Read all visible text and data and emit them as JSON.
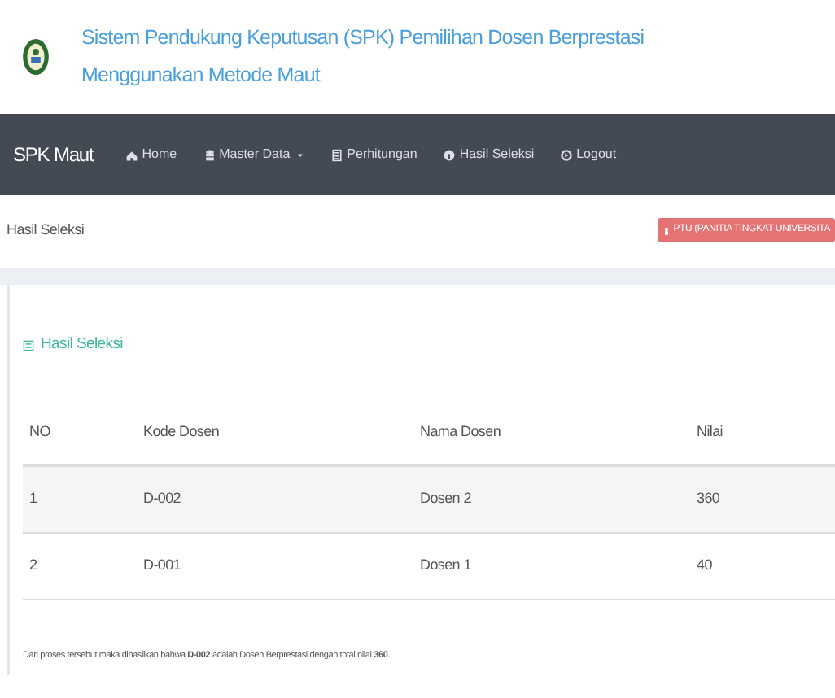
{
  "header": {
    "title_line_1": "Sistem Pendukung Keputusan (SPK) Pemilihan Dosen Berprestasi",
    "title_line_2": "Menggunakan Metode Maut"
  },
  "navbar": {
    "brand": "SPK Maut",
    "items": [
      {
        "label": "Home",
        "kind": "home",
        "dropdown": false
      },
      {
        "label": "Master Data",
        "kind": "database",
        "dropdown": true
      },
      {
        "label": "Perhitungan",
        "kind": "calculator",
        "dropdown": false
      },
      {
        "label": "Hasil Seleksi",
        "kind": "info",
        "dropdown": false
      },
      {
        "label": "Logout",
        "kind": "logout",
        "dropdown": false
      }
    ]
  },
  "page_title": "Hasil Seleksi",
  "user_button": "PTU (PANITIA TINGKAT UNIVERSITA",
  "panel": {
    "title": "Hasil Seleksi",
    "table": {
      "columns": [
        "NO",
        "Kode Dosen",
        "Nama Dosen",
        "Nilai"
      ],
      "rows": [
        [
          "1",
          "D-002",
          "Dosen 2",
          "360"
        ],
        [
          "2",
          "D-001",
          "Dosen 1",
          "40"
        ]
      ]
    },
    "conclusion": "Dari proses tersebut maka dihasilkan bahwa **D-002** adalah Dosen Berprestasi dengan total nilai **360**."
  }
}
